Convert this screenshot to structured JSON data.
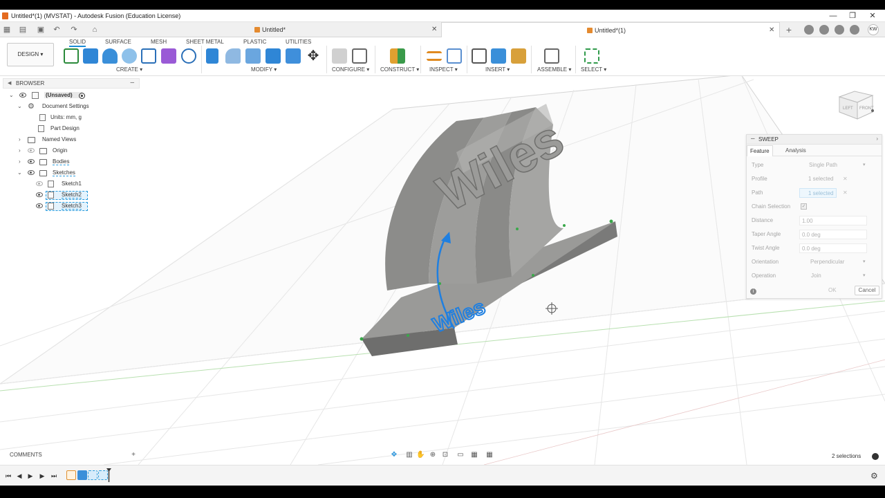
{
  "window": {
    "title": "Untitled*(1) (MVSTAT) - Autodesk Fusion (Education License)",
    "minimize": "—",
    "maximize": "❐",
    "close": "✕"
  },
  "tabs": [
    {
      "label": "Untitled*",
      "active": false
    },
    {
      "label": "Untitled*(1)",
      "active": true
    }
  ],
  "user_initials": "KW",
  "toolbar": {
    "workspace": "DESIGN ▾",
    "workspace_tabs": [
      "SOLID",
      "SURFACE",
      "MESH",
      "SHEET METAL",
      "PLASTIC",
      "UTILITIES"
    ],
    "groups": [
      "CREATE ▾",
      "MODIFY ▾",
      "CONFIGURE ▾",
      "CONSTRUCT ▾",
      "INSPECT ▾",
      "INSERT ▾",
      "ASSEMBLE ▾",
      "SELECT ▾"
    ]
  },
  "browser": {
    "title": "BROWSER",
    "items": [
      {
        "label": "(Unsaved)"
      },
      {
        "label": "Document Settings"
      },
      {
        "label": "Units: mm, g"
      },
      {
        "label": "Part Design"
      },
      {
        "label": "Named Views"
      },
      {
        "label": "Origin"
      },
      {
        "label": "Bodies"
      },
      {
        "label": "Sketches"
      },
      {
        "label": "Sketch1"
      },
      {
        "label": "Sketch2"
      },
      {
        "label": "Sketch3"
      }
    ]
  },
  "model": {
    "text": "Wiles"
  },
  "sweep": {
    "title": "SWEEP",
    "tab_feature": "Feature",
    "tab_analysis": "Analysis",
    "rows": [
      {
        "label": "Type",
        "value": "Single Path"
      },
      {
        "label": "Profile",
        "value": "1 selected"
      },
      {
        "label": "Path",
        "value": "1 selected"
      },
      {
        "label": "Chain Selection",
        "value": "✓"
      },
      {
        "label": "Distance",
        "value": "1.00"
      },
      {
        "label": "Taper Angle",
        "value": "0.0 deg"
      },
      {
        "label": "Twist Angle",
        "value": "0.0 deg"
      },
      {
        "label": "Orientation",
        "value": "Perpendicular"
      },
      {
        "label": "Operation",
        "value": "Join"
      }
    ],
    "ok": "OK",
    "cancel": "Cancel"
  },
  "viewcube": {
    "left": "LEFT",
    "front": "FRONT"
  },
  "comments": "COMMENTS",
  "status": {
    "selections": "2 selections"
  },
  "colors": {
    "accent": "#1a8cd8",
    "model_gray": "#8e8e8c",
    "path_blue": "#1f7fe0",
    "grid": "#dcdcdc"
  }
}
